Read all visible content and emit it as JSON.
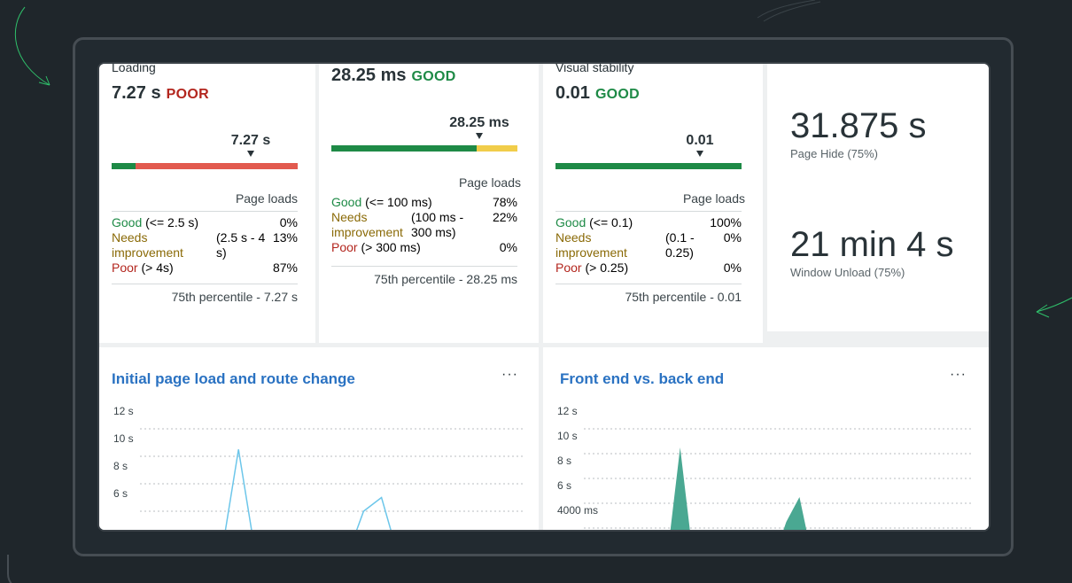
{
  "colors": {
    "good": "#1e8a46",
    "needs_improvement": "#f1cd4a",
    "poor": "#e25a4f",
    "chart_title": "#2a72c2",
    "line_series": "#6cc6ea",
    "area_series": "#4aa892"
  },
  "loading_card": {
    "title": "Loading",
    "value": "7.27 s",
    "status": "POOR",
    "marker_label": "7.27 s",
    "marker_position_fraction": 0.75,
    "bar_segments": [
      {
        "rating": "good",
        "fraction": 0.13
      },
      {
        "rating": "poor",
        "fraction": 0.87
      }
    ],
    "page_loads_label": "Page loads",
    "good_label": "Good",
    "good_range": "(<= 2.5 s)",
    "good_pct": "0%",
    "needs_label_1": "Needs",
    "needs_label_2": "improvement",
    "needs_range_1": "(2.5 s - 4",
    "needs_range_2": "s)",
    "needs_pct": "13%",
    "poor_label": "Poor",
    "poor_range": "(> 4s)",
    "poor_pct": "87%",
    "percentile": "75th percentile - 7.27 s"
  },
  "interactivity_card": {
    "value": "28.25 ms",
    "status": "GOOD",
    "marker_label": "28.25 ms",
    "marker_position_fraction": 0.75,
    "bar_segments": [
      {
        "rating": "good",
        "fraction": 0.78
      },
      {
        "rating": "needs_improvement",
        "fraction": 0.22
      }
    ],
    "page_loads_label": "Page loads",
    "good_label": "Good",
    "good_range": "(<= 100 ms)",
    "good_pct": "78%",
    "needs_label_1": "Needs",
    "needs_label_2": "improvement",
    "needs_range_1": "(100 ms -",
    "needs_range_2": "300 ms)",
    "needs_pct": "22%",
    "poor_label": "Poor",
    "poor_range": "(> 300 ms)",
    "poor_pct": "0%",
    "percentile": "75th percentile - 28.25 ms"
  },
  "stability_card": {
    "title": "Visual stability",
    "value": "0.01",
    "status": "GOOD",
    "marker_label": "0.01",
    "marker_position_fraction": 0.75,
    "bar_segments": [
      {
        "rating": "good",
        "fraction": 1.0
      }
    ],
    "page_loads_label": "Page loads",
    "good_label": "Good",
    "good_range": "(<= 0.1)",
    "good_pct": "100%",
    "needs_label_1": "Needs",
    "needs_label_2": "improvement",
    "needs_range_1": "(0.1 -",
    "needs_range_2": "0.25)",
    "needs_pct": "0%",
    "poor_label": "Poor",
    "poor_range": "(> 0.25)",
    "poor_pct": "0%",
    "percentile": "75th percentile - 0.01"
  },
  "summary_card": {
    "page_hide_value": "31.875 s",
    "page_hide_label": "Page Hide (75%)",
    "window_unload_value": "21 min 4 s",
    "window_unload_label": "Window Unload (75%)"
  },
  "chart_data": [
    {
      "type": "line",
      "title": "Initial page load and route change",
      "more_label": "···",
      "y_ticks": [
        "12 s",
        "10 s",
        "8 s",
        "6 s"
      ],
      "y_tick_values": [
        12,
        10,
        8,
        6
      ],
      "ylim": [
        5.5,
        12
      ],
      "series": [
        {
          "values": [
            0,
            0,
            0,
            0,
            0,
            0,
            0,
            10.5,
            0,
            0,
            0,
            0,
            0,
            0,
            6.0,
            7.0,
            0,
            0,
            0,
            0,
            0,
            0,
            0,
            0
          ]
        }
      ]
    },
    {
      "type": "area",
      "title": "Front end vs. back end",
      "more_label": "···",
      "y_ticks": [
        "12 s",
        "10 s",
        "8 s",
        "6 s",
        "4000 ms"
      ],
      "y_tick_values": [
        12,
        10,
        8,
        6,
        4
      ],
      "ylim": [
        3.5,
        12
      ],
      "series": [
        {
          "values": [
            0,
            0,
            0,
            0,
            0,
            0,
            0,
            0,
            0,
            10.5,
            0,
            0,
            0,
            0,
            0,
            0,
            0,
            4.5,
            6.5,
            0,
            0,
            0,
            0,
            0,
            0,
            0,
            0,
            0,
            0,
            0,
            0,
            0
          ]
        }
      ]
    }
  ]
}
